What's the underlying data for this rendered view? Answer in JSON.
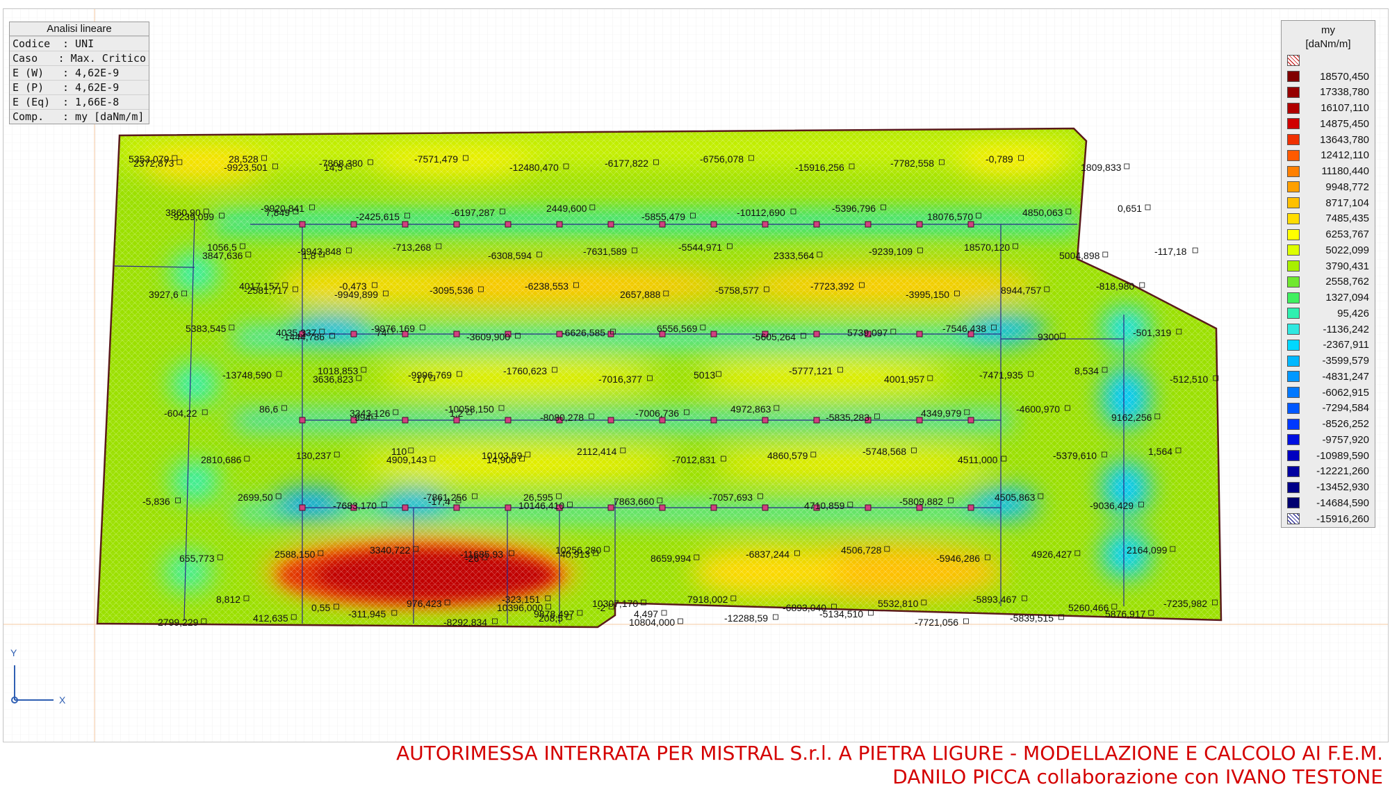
{
  "info_box": {
    "header": "Analisi lineare",
    "rows": [
      {
        "key": "Codice",
        "value": ": UNI"
      },
      {
        "key": "Caso",
        "value": ": Max. Critico"
      },
      {
        "key": "E (W)",
        "value": ": 4,62E-9"
      },
      {
        "key": "E (P)",
        "value": ": 4,62E-9"
      },
      {
        "key": "E (Eq)",
        "value": ": 1,66E-8"
      },
      {
        "key": "Comp.",
        "value": ": my [daNm/m]"
      }
    ]
  },
  "legend": {
    "quantity": "my",
    "unit": "[daNm/m]",
    "over_color": "#c00000",
    "under_color": "#000080",
    "items": [
      {
        "value": "18570,450",
        "color": "#800000"
      },
      {
        "value": "17338,780",
        "color": "#960000"
      },
      {
        "value": "16107,110",
        "color": "#b00000"
      },
      {
        "value": "14875,450",
        "color": "#d00000"
      },
      {
        "value": "13643,780",
        "color": "#f03000"
      },
      {
        "value": "12412,110",
        "color": "#ff5a00"
      },
      {
        "value": "11180,440",
        "color": "#ff8000"
      },
      {
        "value": "9948,772",
        "color": "#ffa000"
      },
      {
        "value": "8717,104",
        "color": "#ffc000"
      },
      {
        "value": "7485,435",
        "color": "#ffdd00"
      },
      {
        "value": "6253,767",
        "color": "#ffff00"
      },
      {
        "value": "5022,099",
        "color": "#ddff00"
      },
      {
        "value": "3790,431",
        "color": "#a8f000"
      },
      {
        "value": "2558,762",
        "color": "#70e830"
      },
      {
        "value": "1327,094",
        "color": "#40f060"
      },
      {
        "value": "95,426",
        "color": "#30f0b0"
      },
      {
        "value": "-1136,242",
        "color": "#30e8e0"
      },
      {
        "value": "-2367,911",
        "color": "#00d8ff"
      },
      {
        "value": "-3599,579",
        "color": "#00b8ff"
      },
      {
        "value": "-4831,247",
        "color": "#0098ff"
      },
      {
        "value": "-6062,915",
        "color": "#0078ff"
      },
      {
        "value": "-7294,584",
        "color": "#0058ff"
      },
      {
        "value": "-8526,252",
        "color": "#0038ff"
      },
      {
        "value": "-9757,920",
        "color": "#0010e0"
      },
      {
        "value": "-10989,590",
        "color": "#0000c0"
      },
      {
        "value": "-12221,260",
        "color": "#0000a0"
      },
      {
        "value": "-13452,930",
        "color": "#000088"
      },
      {
        "value": "-14684,590",
        "color": "#000070"
      }
    ],
    "min_value": "-15916,260"
  },
  "axes": {
    "y_label": "Y",
    "x_label": "X"
  },
  "footer": {
    "line1": "AUTORIMESSA INTERRATA PER MISTRAL S.r.l. A PIETRA LIGURE - MODELLAZIONE E CALCOLO AI F.E.M.",
    "line2": "DANILO PICCA collaborazione con IVANO TESTONE"
  },
  "annotations": [
    "5353,079",
    "3860,90",
    "3847,636",
    "4017,157",
    "4035,337",
    "3636,823",
    "3343,126",
    "4909,143",
    "-7861,256",
    "-11685,93",
    "10396,000",
    "9878,497",
    "-9923,501",
    "-9920,841",
    "-9943,848",
    "-9949,899",
    "-9976,169",
    "-9996,769",
    "-10058,150",
    "10103,59",
    "10146,410",
    "10256,280",
    "10307,170",
    "10804,000",
    "-7868,380",
    "-2425,615",
    "-713,268",
    "-3095,536",
    "-3609,900",
    "-1760,623",
    "-8080,278",
    "2112,414",
    "7863,660",
    "8659,994",
    "7918,002",
    "-12288,59",
    "-7571,479",
    "-6197,287",
    "-6308,594",
    "-6238,553",
    "-6626,585",
    "-7016,377",
    "-7006,736",
    "-7012,831",
    "-7057,693",
    "-6837,244",
    "-6893,040",
    "-5134,510",
    "-12480,470",
    "2449,600",
    "-7631,589",
    "2657,888",
    "6556,569",
    "5013",
    "4972,863",
    "4860,579",
    "4710,859",
    "4506,728",
    "5532,810",
    "-7721,056",
    "-6177,822",
    "-5855,479",
    "-5544,971",
    "-5758,577",
    "-5605,264",
    "-5777,121",
    "-5835,283",
    "-5748,568",
    "-5809,882",
    "-5946,286",
    "-5893,467",
    "-5839,515",
    "-6756,078",
    "-10112,690",
    "2333,564",
    "-7723,392",
    "5739,097",
    "4001,957",
    "4349,979",
    "4511,000",
    "4505,863",
    "4926,427",
    "5260,466",
    "5876,917",
    "-15916,256",
    "-5396,796",
    "-9239,109",
    "-3995,150",
    "-7546,438",
    "-7471,935",
    "-4600,970",
    "-5379,610",
    "-9036,429",
    "2164,099",
    "-7235,982",
    "2799,229",
    "-7782,558",
    "18076,570",
    "18570,120",
    "8944,757",
    "9300",
    "8,534",
    "9162,256",
    "1,564",
    "-5,836",
    "655,773",
    "8,812",
    "412,635",
    "-0,789",
    "4850,063",
    "5004,898",
    "-818,980",
    "-501,319",
    "-512,510",
    "-604,22",
    "2810,686",
    "2699,50",
    "2588,150",
    "0,55",
    "-311,945",
    "1809,833",
    "0,651",
    "-117,18",
    "3927,6",
    "5383,545",
    "-13748,590",
    "86,6",
    "130,237",
    "-7683,170",
    "3340,722",
    "976,423",
    "-8292,834",
    "2372,873",
    "-9239,099",
    "1056,5",
    "-2581,717",
    "-1444,786",
    "1018,853",
    "994",
    "110",
    "-17,4",
    "-26",
    "-323,151",
    "208,5",
    "28,528",
    "7,849",
    "1,8",
    "-0,473",
    "74",
    "-17",
    "1,2",
    "14,900",
    "26,595",
    "40,913",
    "-2",
    "4,497",
    "14,5"
  ]
}
